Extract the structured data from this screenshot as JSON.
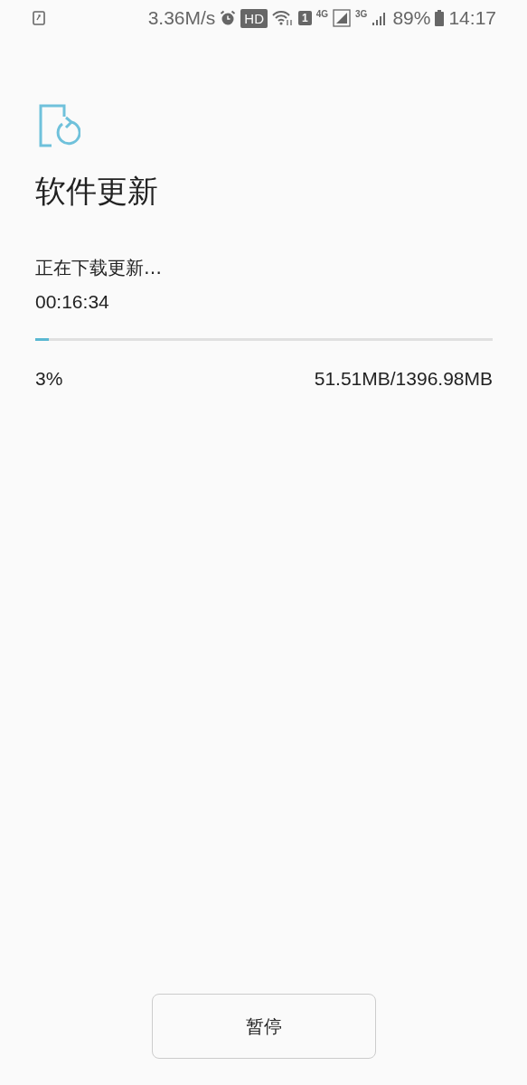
{
  "status_bar": {
    "speed": "3.36M/s",
    "hd": "HD",
    "sim": "1",
    "net_1": "4G",
    "net_2": "3G",
    "battery": "89%",
    "time": "14:17"
  },
  "title": "软件更新",
  "download": {
    "status": "正在下载更新…",
    "elapsed": "00:16:34",
    "level": 0.03,
    "percent": "3%",
    "size": "51.51MB/1396.98MB"
  },
  "buttons": [
    "暂停"
  ]
}
